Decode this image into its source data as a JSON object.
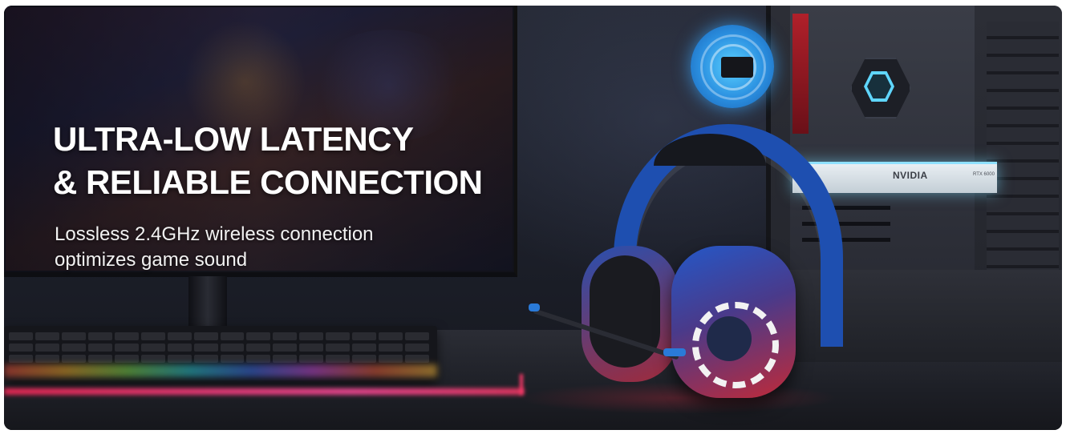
{
  "banner": {
    "headline": {
      "line1": "ULTRA-LOW LATENCY",
      "line2": "& RELIABLE CONNECTION"
    },
    "subtext": {
      "line1": "Lossless 2.4GHz wireless connection",
      "line2": "optimizes game sound"
    },
    "scene": {
      "gpu_brand": "NVIDIA",
      "gpu_model": "RTX 6000",
      "accent_color": "#5fd6ff",
      "dongle_color": "#2a8fe0",
      "headset_primary_color": "#1e4fb0",
      "headset_secondary_color": "#c02a38",
      "mat_glow_color": "#ff3a6a"
    }
  }
}
